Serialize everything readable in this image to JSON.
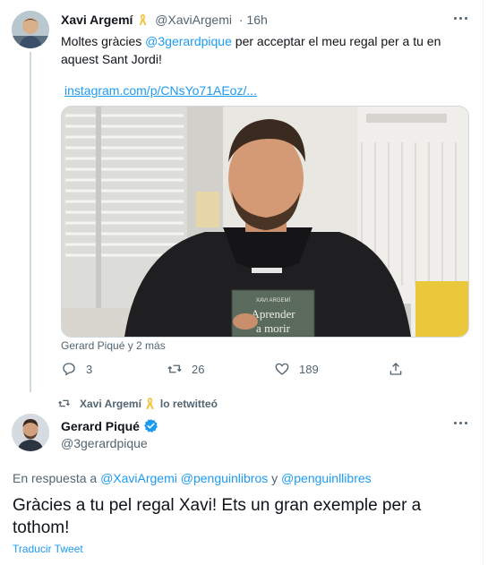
{
  "tweet1": {
    "author_name": "Xavi Argemí",
    "author_handle": "@XaviArgemi",
    "time": "· 16h",
    "text_before": "Moltes gràcies ",
    "mention": "@3gerardpique",
    "text_after": " per acceptar el meu regal per a tu en aquest Sant Jordi!",
    "link": "instagram.com/p/CNsYo71AEoz/...",
    "book_author": "XAVI ARGEMÍ",
    "book_title_1": "Aprender",
    "book_title_2": "a morir",
    "tagged": "Gerard Piqué y 2 más",
    "replies": "3",
    "retweets": "26",
    "likes": "189"
  },
  "retweet_notice": {
    "name": "Xavi Argemí",
    "suffix": "lo retwitteó"
  },
  "tweet2": {
    "author_name": "Gerard Piqué",
    "author_handle": "@3gerardpique",
    "reply_prefix": "En respuesta a ",
    "reply_mentions": [
      "@XaviArgemi",
      "@penguinlibros",
      "@penguinllibres"
    ],
    "reply_joiner": " y ",
    "text": "Gràcies a tu pel regal Xavi! Ets un gran exemple per a tothom!",
    "translate": "Traducir Tweet"
  },
  "colors": {
    "accent": "#1d9bf0",
    "secondary_text": "#536471",
    "primary_text": "#0f1419",
    "ribbon": "#f2c33b"
  },
  "icons": [
    "ribbon-icon",
    "more-options-icon",
    "reply-icon",
    "retweet-icon",
    "like-icon",
    "share-icon",
    "verified-badge-icon"
  ]
}
